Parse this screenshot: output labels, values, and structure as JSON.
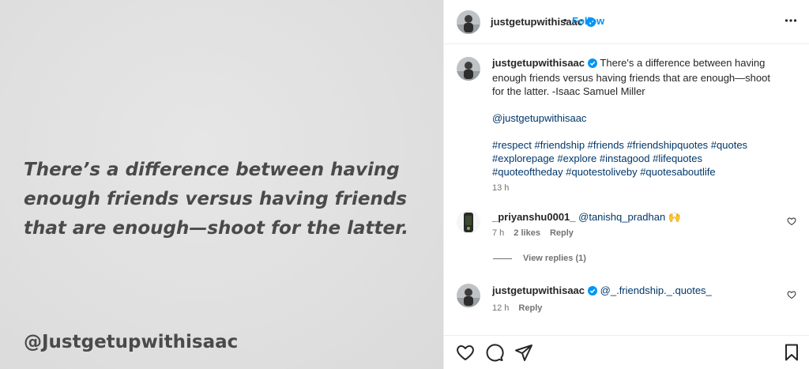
{
  "post": {
    "quote_text": "There’s a difference between having enough friends versus having friends that are enough—shoot for the latter.",
    "watermark": "@Justgetupwithisaac"
  },
  "header": {
    "username": "justgetupwithisaac",
    "dot": "•",
    "follow_label": "Follow"
  },
  "caption": {
    "username": "justgetupwithisaac",
    "text": "There's a difference between having enough friends versus having friends that are enough—shoot for the latter. -Isaac Samuel Miller",
    "mention": "@justgetupwithisaac",
    "hashtags": "#respect #friendship #friends #friendshipquotes #quotes #explorepage #explore #instagood #lifequotes #quoteoftheday #quotestoliveby #quotesaboutlife",
    "time": "13 h"
  },
  "comments": [
    {
      "username": "_priyanshu0001_",
      "mention": "@tanishq_pradhan",
      "emoji": "🙌",
      "time": "7 h",
      "likes": "2 likes",
      "reply_label": "Reply"
    },
    {
      "username": "justgetupwithisaac",
      "mention": "@_.friendship._.quotes_",
      "time": "12 h",
      "reply_label": "Reply"
    }
  ],
  "view_replies_label": "View replies (1)",
  "colors": {
    "link": "#00376b",
    "follow": "#0095f6",
    "verified": "#0095f6"
  },
  "icons": [
    "heart-icon",
    "comment-icon",
    "share-icon",
    "bookmark-icon",
    "more-icon",
    "verified-badge-icon"
  ]
}
